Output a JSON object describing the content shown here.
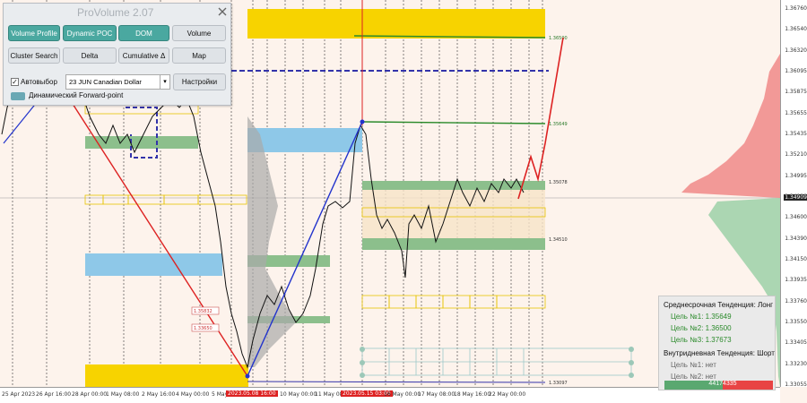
{
  "panel": {
    "title": "ProVolume 2.07",
    "buttons": {
      "volume_profile": "Volume Profile",
      "dynamic_poc": "Dynamic POC",
      "dom": "DOM",
      "volume": "Volume",
      "cluster_search": "Cluster Search",
      "delta": "Delta",
      "cumulative_delta": "Cumulative Δ",
      "map": "Map",
      "settings": "Настройки"
    },
    "autoselect_label": "Автовыбор",
    "autoselect_checked": true,
    "instrument": "23 JUN Canadian Dollar",
    "forward_point_label": "Динамический Forward-point"
  },
  "price_axis": {
    "ticks": [
      "1.36760",
      "1.36540",
      "1.36320",
      "1.36095",
      "1.35875",
      "1.35655",
      "1.35435",
      "1.35210",
      "1.34995",
      "1.34820",
      "1.34600",
      "1.34390",
      "1.34150",
      "1.33935",
      "1.33760",
      "1.33550",
      "1.33405",
      "1.33230",
      "1.33055"
    ],
    "current_price": "1.34909"
  },
  "time_axis": {
    "ticks": [
      "25 Apr 2023",
      "26 Apr 16:00",
      "28 Apr 00:00",
      "1 May 08:00",
      "2 May 16:00",
      "4 May 00:00",
      "5 May 08:00",
      "2023.05.08 16:00",
      "10 May 00:00",
      "11 May 08:00",
      "2023.05.15 03:00",
      "16 May 00:00",
      "17 May 08:00",
      "18 May 16:00",
      "22 May 00:00"
    ],
    "highlighted": [
      "2023.05.08 16:00",
      "2023.05.15 03:00"
    ]
  },
  "levels": {
    "upper_target": "1.36500",
    "green_upper": "1.35649",
    "mid_green": "1.35078",
    "low_green": "1.34510",
    "bottom": "1.33097",
    "box_label_1": "1.35832",
    "box_label_2": "1.33650"
  },
  "trend": {
    "medium_title": "Среднесрочная Тенденция: Лонг",
    "medium_targets": [
      "Цель №1: 1.35649",
      "Цель №2: 1.36500",
      "Цель №3: 1.37673"
    ],
    "intraday_title": "Внутридневная Тенденция: Шорт",
    "intraday_targets": [
      "Цель №1: нет",
      "Цель №2: нет"
    ],
    "buy_volume": "4417",
    "sell_volume": "4335"
  },
  "colors": {
    "background": "#fdf3ec",
    "gold_zone": "#f7d300",
    "blue_zone": "#8ec8e8",
    "green_zone": "#8cbf8c",
    "sell_profile": "#f08888",
    "buy_profile": "#9cd0a8",
    "teal_button": "#4aa8a0",
    "down_line": "#dd2222",
    "up_line": "#2233cc"
  }
}
